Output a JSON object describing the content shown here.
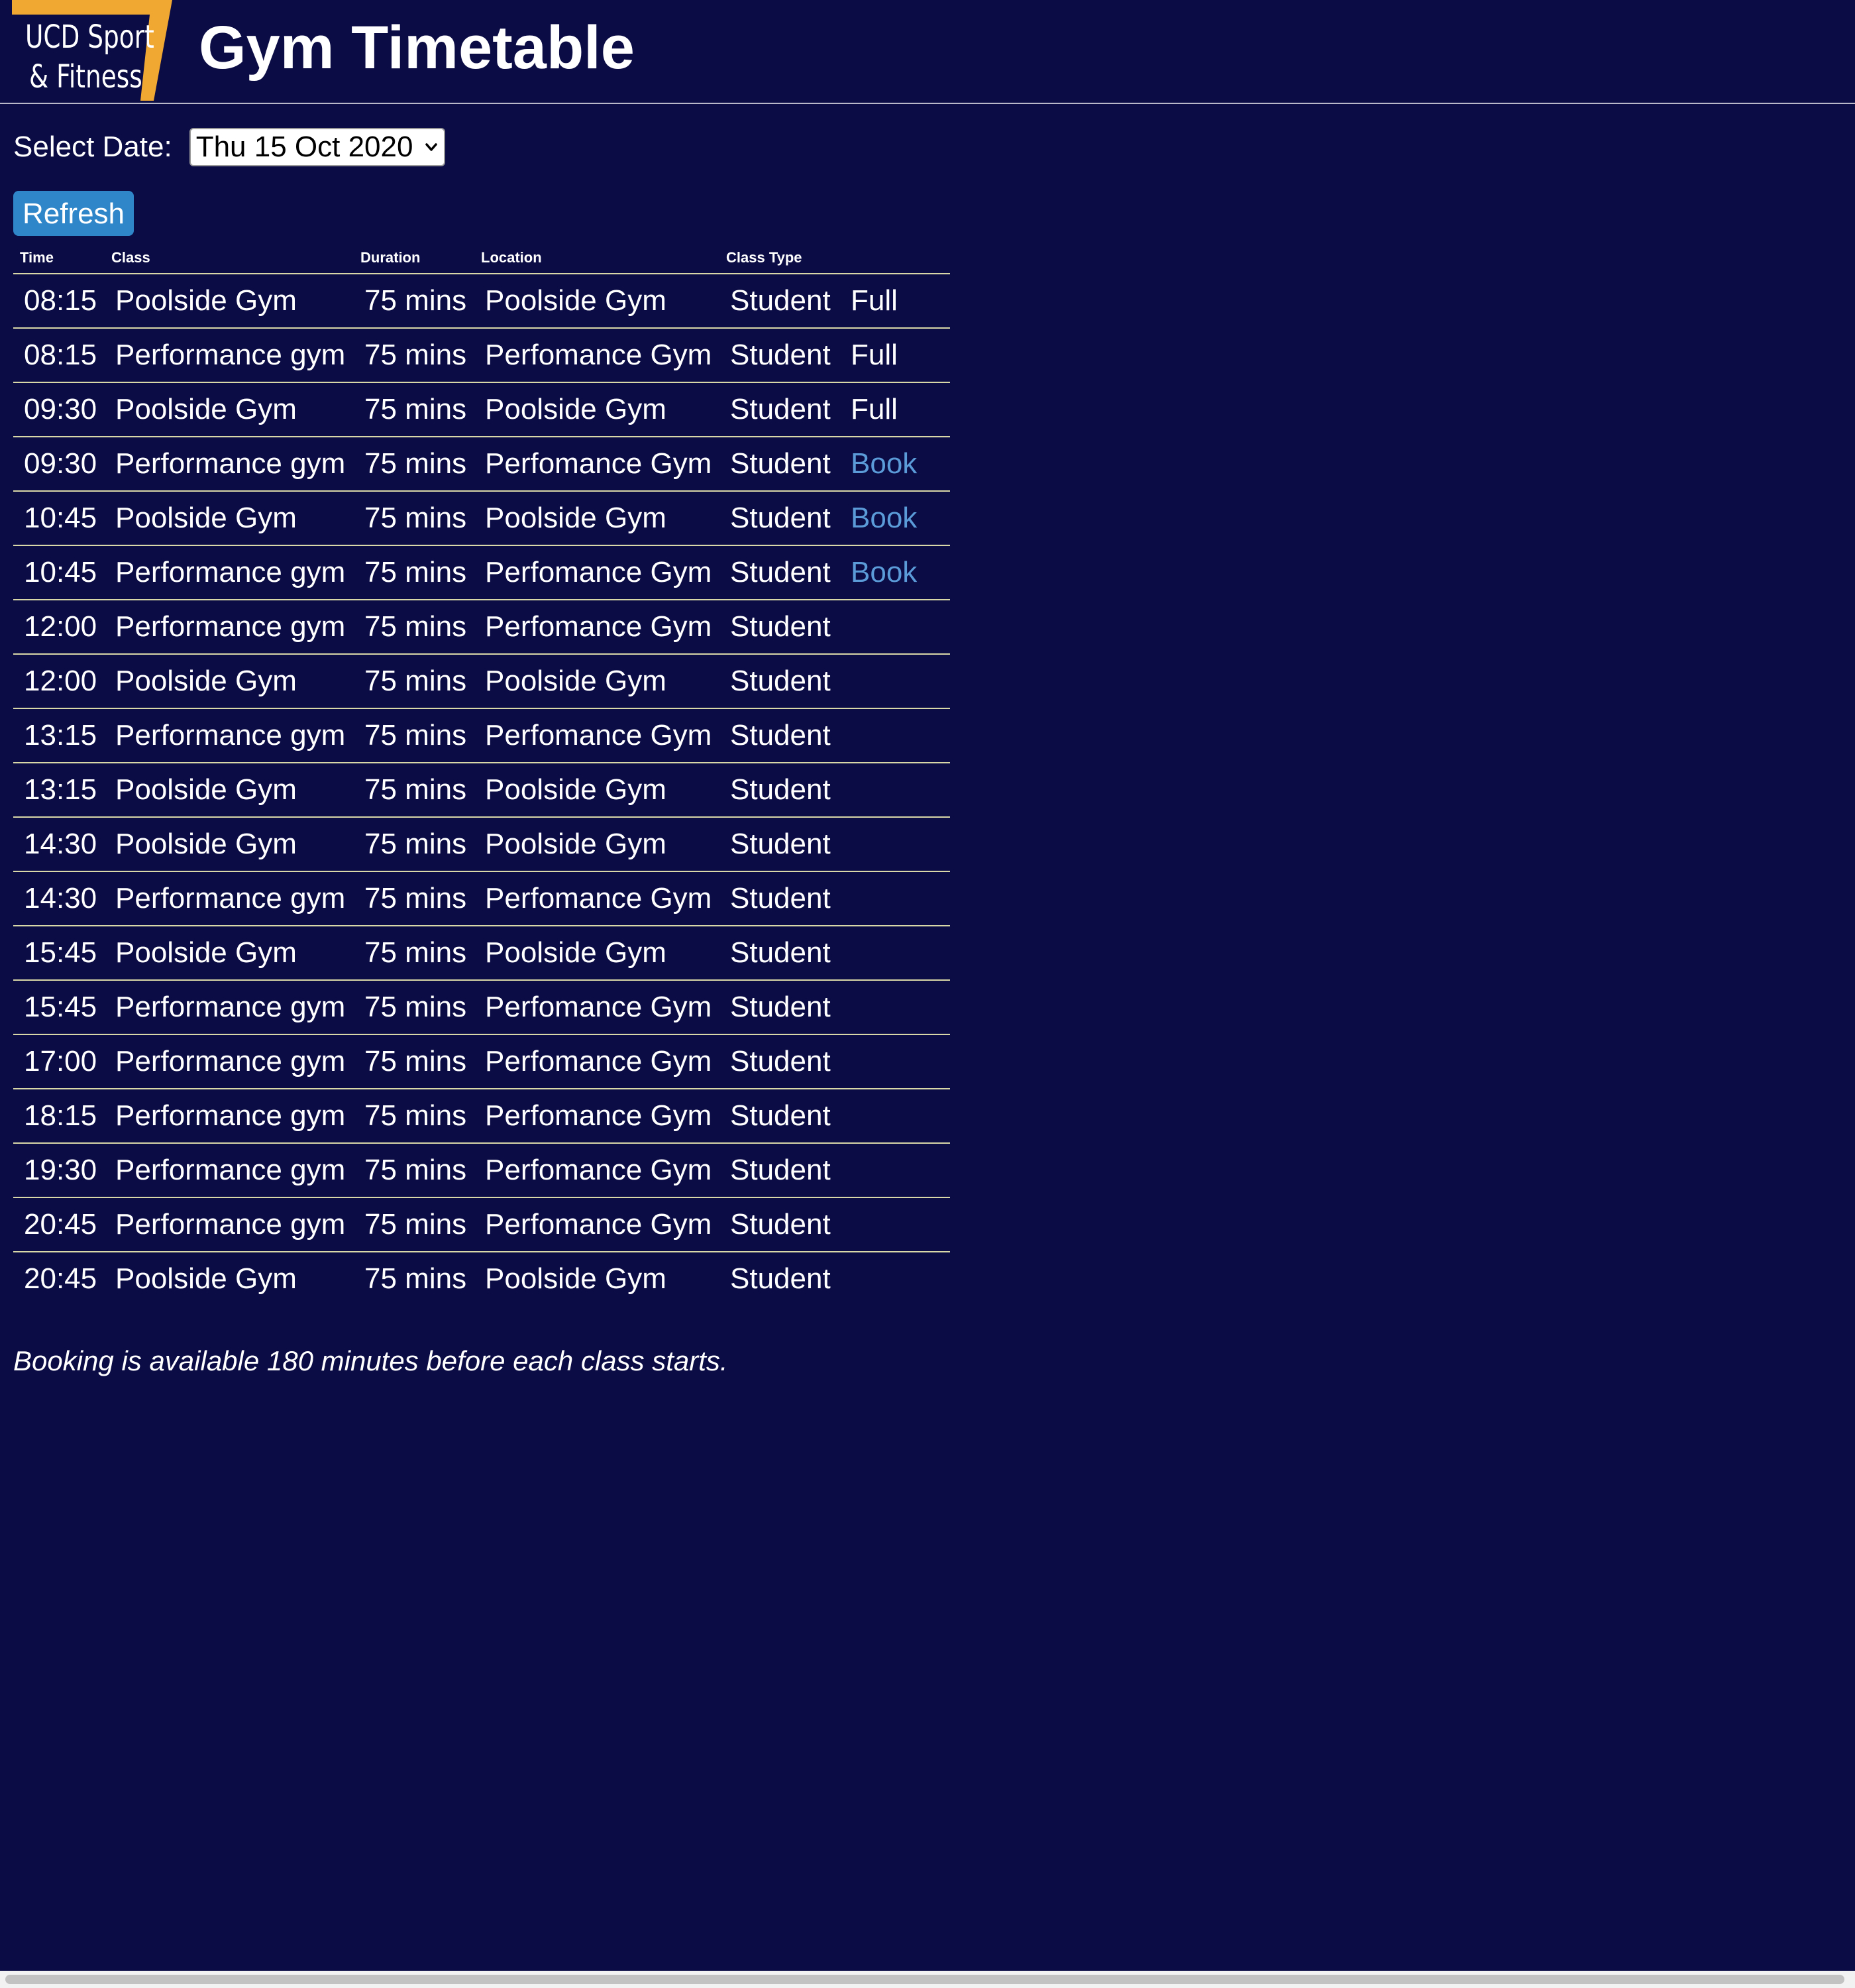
{
  "header": {
    "logo_line1": "UCD Sport",
    "logo_line2": "& Fitness",
    "title": "Gym Timetable",
    "logo_accent_color": "#f0a832"
  },
  "date_filter": {
    "label": "Select Date:",
    "selected": "Thu 15 Oct 2020"
  },
  "refresh_label": "Refresh",
  "table": {
    "columns": [
      "Time",
      "Class",
      "Duration",
      "Location",
      "Class Type",
      ""
    ],
    "rows": [
      {
        "time": "08:15",
        "class": "Poolside Gym",
        "duration": "75 mins",
        "location": "Poolside Gym",
        "type": "Student",
        "status": "Full"
      },
      {
        "time": "08:15",
        "class": "Performance gym",
        "duration": "75 mins",
        "location": "Perfomance Gym",
        "type": "Student",
        "status": "Full"
      },
      {
        "time": "09:30",
        "class": "Poolside Gym",
        "duration": "75 mins",
        "location": "Poolside Gym",
        "type": "Student",
        "status": "Full"
      },
      {
        "time": "09:30",
        "class": "Performance gym",
        "duration": "75 mins",
        "location": "Perfomance Gym",
        "type": "Student",
        "status": "Book"
      },
      {
        "time": "10:45",
        "class": "Poolside Gym",
        "duration": "75 mins",
        "location": "Poolside Gym",
        "type": "Student",
        "status": "Book"
      },
      {
        "time": "10:45",
        "class": "Performance gym",
        "duration": "75 mins",
        "location": "Perfomance Gym",
        "type": "Student",
        "status": "Book"
      },
      {
        "time": "12:00",
        "class": "Performance gym",
        "duration": "75 mins",
        "location": "Perfomance Gym",
        "type": "Student",
        "status": ""
      },
      {
        "time": "12:00",
        "class": "Poolside Gym",
        "duration": "75 mins",
        "location": "Poolside Gym",
        "type": "Student",
        "status": ""
      },
      {
        "time": "13:15",
        "class": "Performance gym",
        "duration": "75 mins",
        "location": "Perfomance Gym",
        "type": "Student",
        "status": ""
      },
      {
        "time": "13:15",
        "class": "Poolside Gym",
        "duration": "75 mins",
        "location": "Poolside Gym",
        "type": "Student",
        "status": ""
      },
      {
        "time": "14:30",
        "class": "Poolside Gym",
        "duration": "75 mins",
        "location": "Poolside Gym",
        "type": "Student",
        "status": ""
      },
      {
        "time": "14:30",
        "class": "Performance gym",
        "duration": "75 mins",
        "location": "Perfomance Gym",
        "type": "Student",
        "status": ""
      },
      {
        "time": "15:45",
        "class": "Poolside Gym",
        "duration": "75 mins",
        "location": "Poolside Gym",
        "type": "Student",
        "status": ""
      },
      {
        "time": "15:45",
        "class": "Performance gym",
        "duration": "75 mins",
        "location": "Perfomance Gym",
        "type": "Student",
        "status": ""
      },
      {
        "time": "17:00",
        "class": "Performance gym",
        "duration": "75 mins",
        "location": "Perfomance Gym",
        "type": "Student",
        "status": ""
      },
      {
        "time": "18:15",
        "class": "Performance gym",
        "duration": "75 mins",
        "location": "Perfomance Gym",
        "type": "Student",
        "status": ""
      },
      {
        "time": "19:30",
        "class": "Performance gym",
        "duration": "75 mins",
        "location": "Perfomance Gym",
        "type": "Student",
        "status": ""
      },
      {
        "time": "20:45",
        "class": "Performance gym",
        "duration": "75 mins",
        "location": "Perfomance Gym",
        "type": "Student",
        "status": ""
      },
      {
        "time": "20:45",
        "class": "Poolside Gym",
        "duration": "75 mins",
        "location": "Poolside Gym",
        "type": "Student",
        "status": ""
      }
    ]
  },
  "note": "Booking is available 180 minutes before each class starts."
}
